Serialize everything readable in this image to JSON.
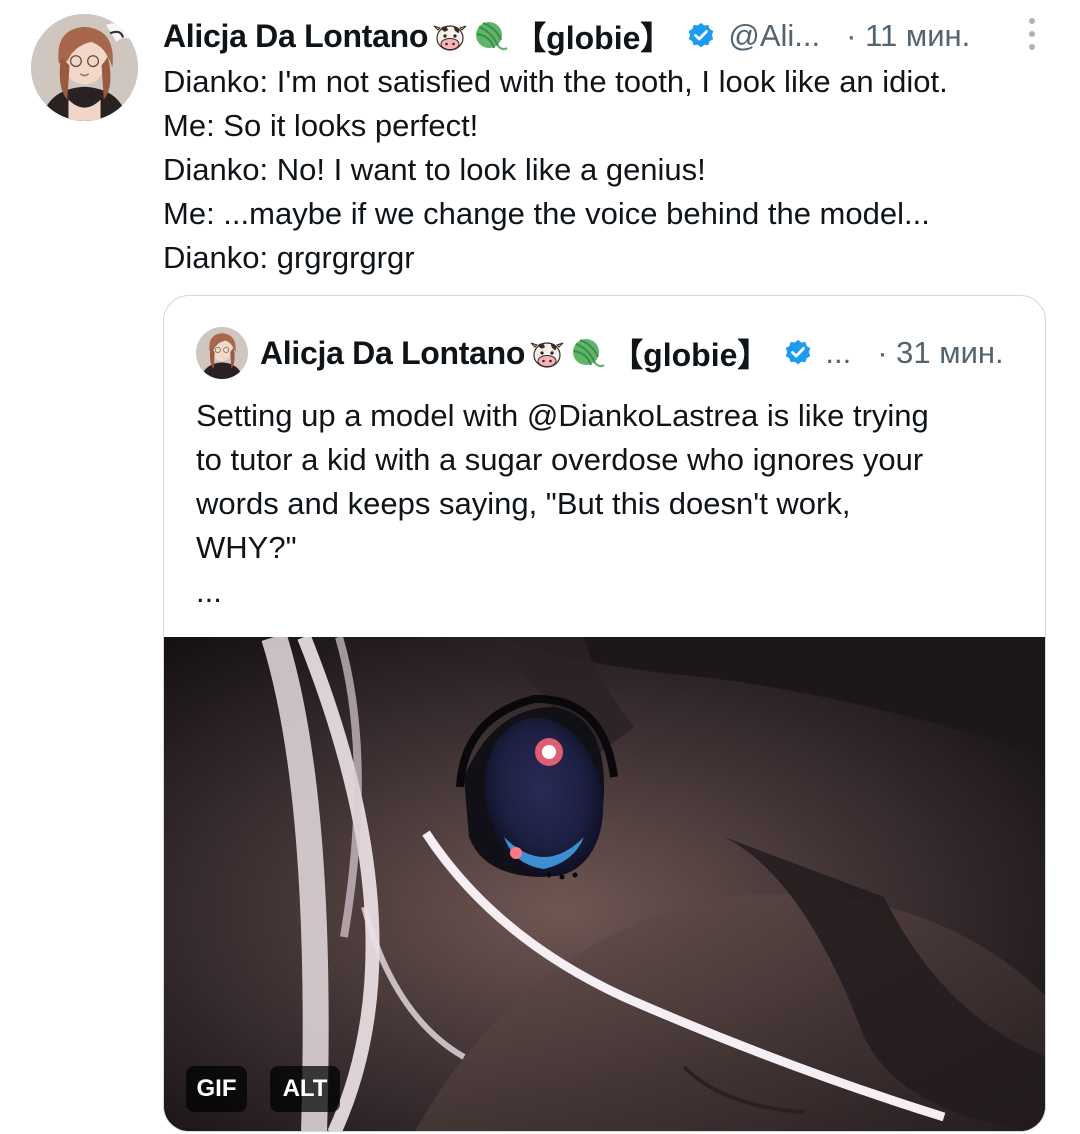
{
  "author": {
    "name": "Alicja Da Lontano",
    "emojis": [
      "cow-face-icon",
      "yarn-ball-icon"
    ],
    "tag": "【globie】",
    "handle": "@Ali...",
    "time": "· 11 мин."
  },
  "post": {
    "lines": [
      "Dianko: I'm not satisfied with the tooth, I look like an idiot.",
      "Me: So it looks perfect!",
      "Dianko: No! I want to look like a genius!",
      "Me: ...maybe if we change the voice behind the model...",
      "Dianko: grgrgrgrgr"
    ]
  },
  "quoted": {
    "name": "Alicja Da Lontano",
    "emojis": [
      "cow-face-icon",
      "yarn-ball-icon"
    ],
    "tag": "【globie】",
    "handle": "...",
    "time": "· 31 мин.",
    "lines": [
      "Setting up a model with @DiankoLastrea is like trying",
      "to tutor a kid with a sugar overdose who ignores your",
      "words and keeps saying, \"But this doesn't work,",
      "WHY?\""
    ],
    "ellipsis": "...",
    "media": {
      "badge_gif": "GIF",
      "badge_alt": "ALT"
    }
  },
  "colors": {
    "text": "#0f1419",
    "secondary": "#536471",
    "border": "#cfd9de",
    "verified": "#1d9bf0"
  }
}
